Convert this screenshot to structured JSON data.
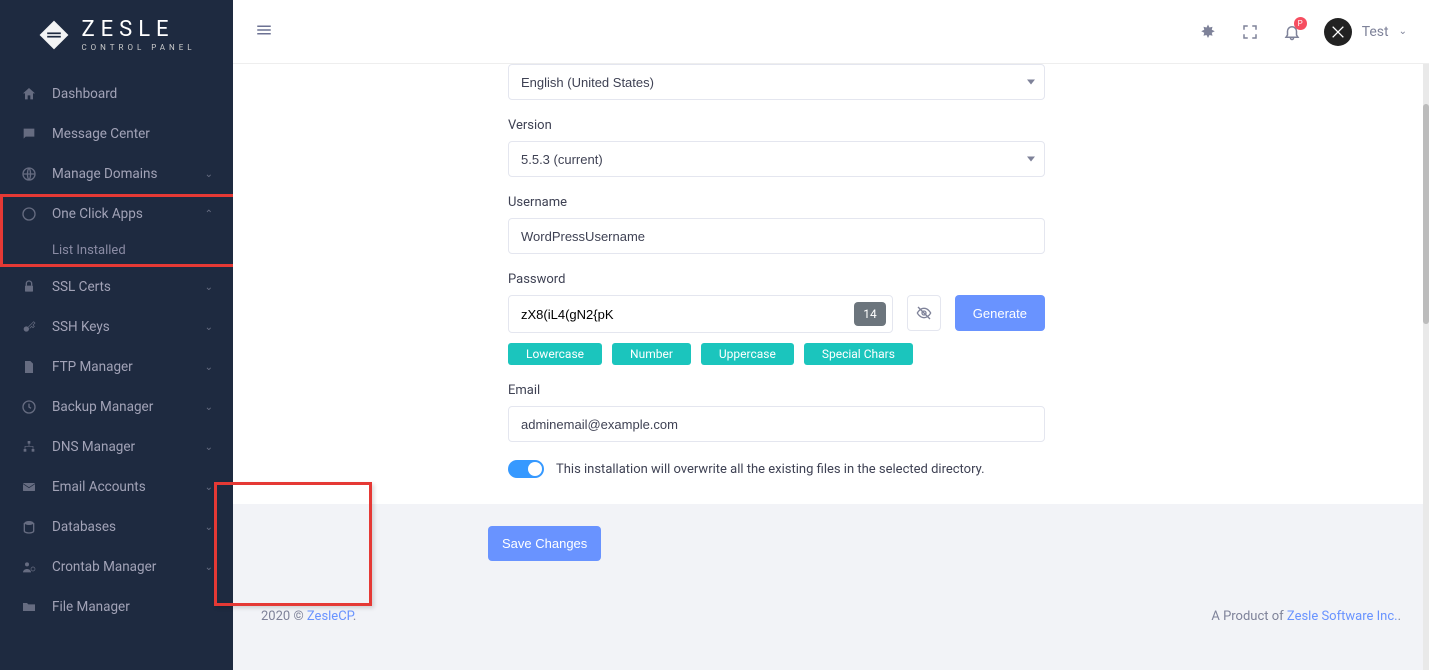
{
  "brand": {
    "title": "ZESLE",
    "subtitle": "CONTROL PANEL"
  },
  "user": {
    "name": "Test"
  },
  "bell_badge": "P",
  "sidebar": {
    "items": [
      {
        "label": "Dashboard"
      },
      {
        "label": "Message Center"
      },
      {
        "label": "Manage Domains"
      },
      {
        "label": "One Click Apps"
      },
      {
        "label": "SSL Certs"
      },
      {
        "label": "SSH Keys"
      },
      {
        "label": "FTP Manager"
      },
      {
        "label": "Backup Manager"
      },
      {
        "label": "DNS Manager"
      },
      {
        "label": "Email Accounts"
      },
      {
        "label": "Databases"
      },
      {
        "label": "Crontab Manager"
      },
      {
        "label": "File Manager"
      }
    ],
    "sub_oneclick": "List Installed"
  },
  "form": {
    "language_value": "English (United States)",
    "version_label": "Version",
    "version_value": "5.5.3 (current)",
    "username_label": "Username",
    "username_value": "WordPressUsername",
    "password_label": "Password",
    "password_value": "zX8(iL4(gN2{pK",
    "password_count": "14",
    "generate_btn": "Generate",
    "badges": [
      "Lowercase",
      "Number",
      "Uppercase",
      "Special Chars"
    ],
    "email_label": "Email",
    "email_value": "adminemail@example.com",
    "overwrite_note": "This installation will overwrite all the existing files in the selected directory."
  },
  "save_btn": "Save Changes",
  "footer": {
    "copyright_prefix": "2020 © ",
    "copyright_link": "ZesleCP",
    "product_prefix": "A Product of ",
    "product_link": "Zesle Software Inc."
  }
}
